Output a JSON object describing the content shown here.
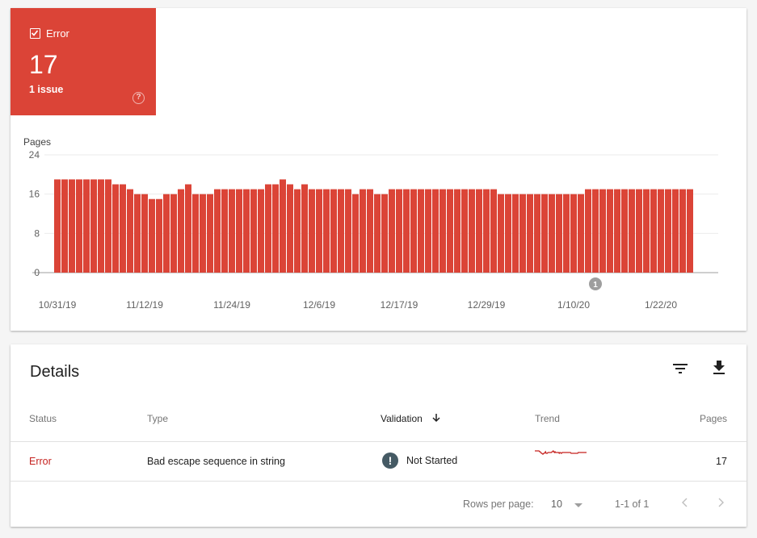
{
  "summary": {
    "label": "Error",
    "checked": true,
    "count": "17",
    "issues": "1 issue",
    "help_icon": "help-circle-icon",
    "color": "#db4437"
  },
  "chart_data": {
    "type": "bar",
    "ylabel": "Pages",
    "xlabel": "",
    "ylim": [
      0,
      24
    ],
    "yticks": [
      0,
      8,
      16,
      24
    ],
    "grid": true,
    "bar_color": "#db4437",
    "start_date": "10/31/19",
    "end_date": "1/28/20",
    "xtick_labels": [
      "10/31/19",
      "11/12/19",
      "11/24/19",
      "12/6/19",
      "12/17/19",
      "12/29/19",
      "1/10/20",
      "1/22/20"
    ],
    "xtick_indices": [
      0,
      12,
      24,
      36,
      47,
      59,
      71,
      83
    ],
    "values": [
      19,
      19,
      19,
      19,
      19,
      19,
      19,
      19,
      18,
      18,
      17,
      16,
      16,
      15,
      15,
      16,
      16,
      17,
      18,
      16,
      16,
      16,
      17,
      17,
      17,
      17,
      17,
      17,
      17,
      18,
      18,
      19,
      18,
      17,
      18,
      17,
      17,
      17,
      17,
      17,
      17,
      16,
      17,
      17,
      16,
      16,
      17,
      17,
      17,
      17,
      17,
      17,
      17,
      17,
      17,
      17,
      17,
      17,
      17,
      17,
      17,
      16,
      16,
      16,
      16,
      16,
      16,
      16,
      16,
      16,
      16,
      16,
      16,
      17,
      17,
      17,
      17,
      17,
      17,
      17,
      17,
      17,
      17,
      17,
      17,
      17,
      17,
      17
    ],
    "annotations": [
      {
        "label": "1",
        "index": 74,
        "date": "1/13/20"
      }
    ]
  },
  "details": {
    "title": "Details",
    "filter_icon": "filter-icon",
    "download_icon": "download-icon",
    "columns": {
      "status": "Status",
      "type": "Type",
      "validation": "Validation",
      "trend": "Trend",
      "pages": "Pages"
    },
    "sort_column": "validation",
    "sort_direction": "descending",
    "rows": [
      {
        "status": "Error",
        "type": "Bad escape sequence in string",
        "validation": "Not Started",
        "validation_icon": "alert-circle-icon",
        "pages": "17"
      }
    ],
    "footer": {
      "rows_per_page_label": "Rows per page:",
      "rows_per_page_value": "10",
      "range": "1-1 of 1",
      "prev_icon": "chevron-left-icon",
      "next_icon": "chevron-right-icon"
    }
  }
}
